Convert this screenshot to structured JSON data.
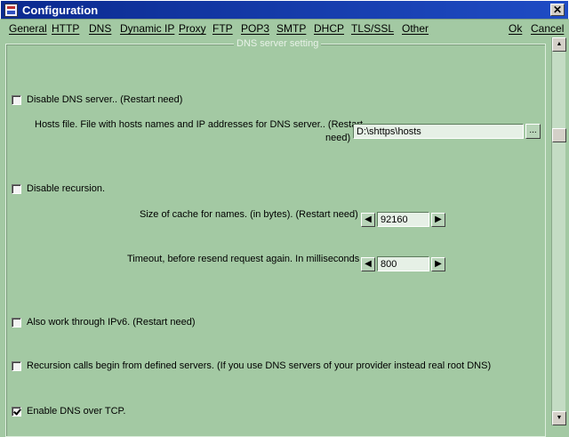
{
  "window": {
    "title": "Configuration",
    "close_symbol": "✕"
  },
  "menu": {
    "items": [
      "General",
      "HTTP",
      "DNS",
      "Dynamic IP",
      "Proxy",
      "FTP",
      "POP3",
      "SMTP",
      "DHCP",
      "TLS/SSL",
      "Other"
    ],
    "ok": "Ok",
    "cancel": "Cancel"
  },
  "group": {
    "title": "DNS server setting"
  },
  "settings": {
    "disable_dns": {
      "label": "Disable DNS server.. (Restart need)",
      "checked": false
    },
    "hosts_file": {
      "label_line1": "Hosts file. File with hosts names and IP addresses for DNS server.. (Restart",
      "label_line2": "need)",
      "value": "D:\\shttps\\hosts",
      "browse": "..."
    },
    "disable_recursion": {
      "label": "Disable recursion.",
      "checked": false
    },
    "cache_size": {
      "label": "Size of cache for names. (in bytes). (Restart need)",
      "value": "92160"
    },
    "timeout": {
      "label": "Timeout, before resend request again. In milliseconds",
      "value": "800"
    },
    "ipv6": {
      "label": "Also work through IPv6. (Restart need)",
      "checked": false
    },
    "recursion_servers": {
      "label": "Recursion calls begin from defined servers. (If you use DNS servers of your provider instead real root DNS)",
      "checked": false
    },
    "dns_tcp": {
      "label": "Enable DNS over TCP.",
      "checked": true
    }
  },
  "icons": {
    "app": "app-icon",
    "close": "close-icon",
    "scroll_up": "scroll-up-icon",
    "scroll_down": "scroll-down-icon",
    "decrement": "left-arrow-icon",
    "increment": "right-arrow-icon"
  },
  "colors": {
    "background": "#a3c9a3",
    "titlebar": "#0b2a8f",
    "group_title": "#e8f2e8"
  }
}
